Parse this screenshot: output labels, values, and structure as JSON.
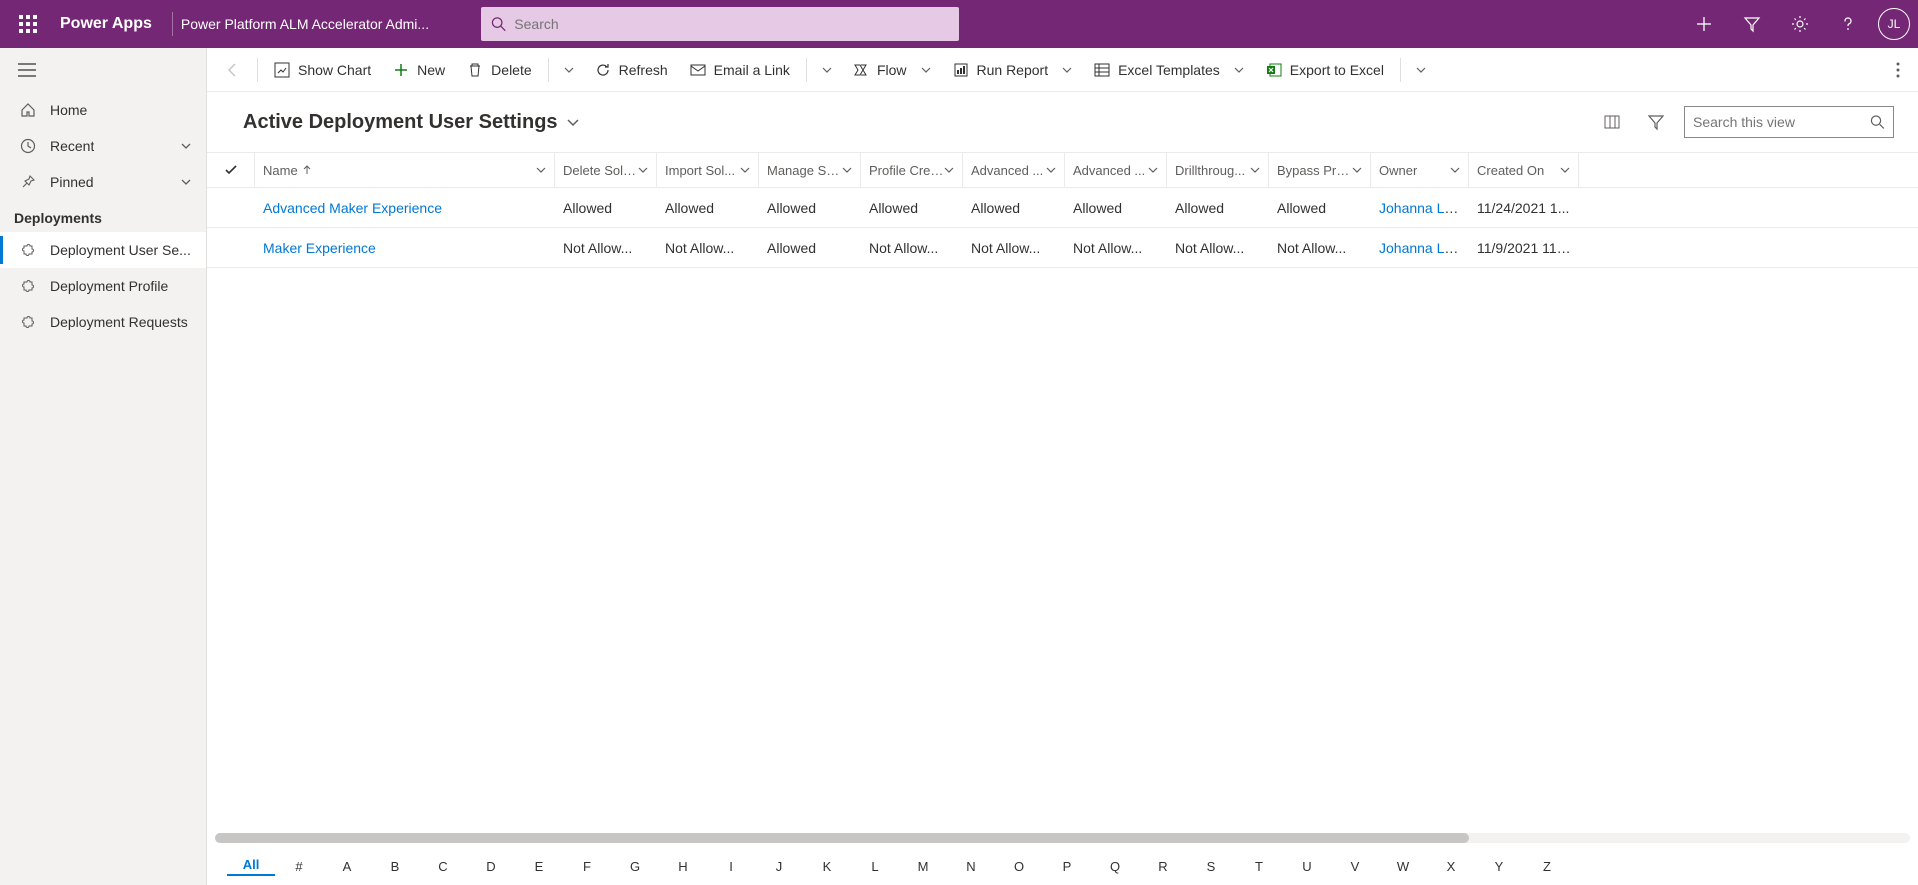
{
  "topbar": {
    "brand": "Power Apps",
    "subtitle": "Power Platform ALM Accelerator Admi...",
    "search_placeholder": "Search",
    "avatar_initials": "JL"
  },
  "sidebar": {
    "home": "Home",
    "recent": "Recent",
    "pinned": "Pinned",
    "section": "Deployments",
    "items": [
      "Deployment User Se...",
      "Deployment Profile",
      "Deployment Requests"
    ]
  },
  "cmdbar": {
    "show_chart": "Show Chart",
    "new": "New",
    "delete": "Delete",
    "refresh": "Refresh",
    "email_link": "Email a Link",
    "flow": "Flow",
    "run_report": "Run Report",
    "excel_templates": "Excel Templates",
    "export_excel": "Export to Excel"
  },
  "view": {
    "title": "Active Deployment User Settings",
    "search_placeholder": "Search this view"
  },
  "grid": {
    "columns": [
      "Name",
      "Delete Solu...",
      "Import Sol...",
      "Manage So...",
      "Profile Crea...",
      "Advanced ...",
      "Advanced ...",
      "Drillthroug...",
      "Bypass Pre...",
      "Owner",
      "Created On"
    ],
    "rows": [
      {
        "name": "Advanced Maker Experience",
        "perms": [
          "Allowed",
          "Allowed",
          "Allowed",
          "Allowed",
          "Allowed",
          "Allowed",
          "Allowed",
          "Allowed"
        ],
        "owner": "Johanna Lorenz",
        "created": "11/24/2021 1..."
      },
      {
        "name": "Maker Experience",
        "perms": [
          "Not Allow...",
          "Not Allow...",
          "Allowed",
          "Not Allow...",
          "Not Allow...",
          "Not Allow...",
          "Not Allow...",
          "Not Allow..."
        ],
        "owner": "Johanna Lorenz",
        "created": "11/9/2021 11:..."
      }
    ]
  },
  "alpha": [
    "All",
    "#",
    "A",
    "B",
    "C",
    "D",
    "E",
    "F",
    "G",
    "H",
    "I",
    "J",
    "K",
    "L",
    "M",
    "N",
    "O",
    "P",
    "Q",
    "R",
    "S",
    "T",
    "U",
    "V",
    "W",
    "X",
    "Y",
    "Z"
  ]
}
